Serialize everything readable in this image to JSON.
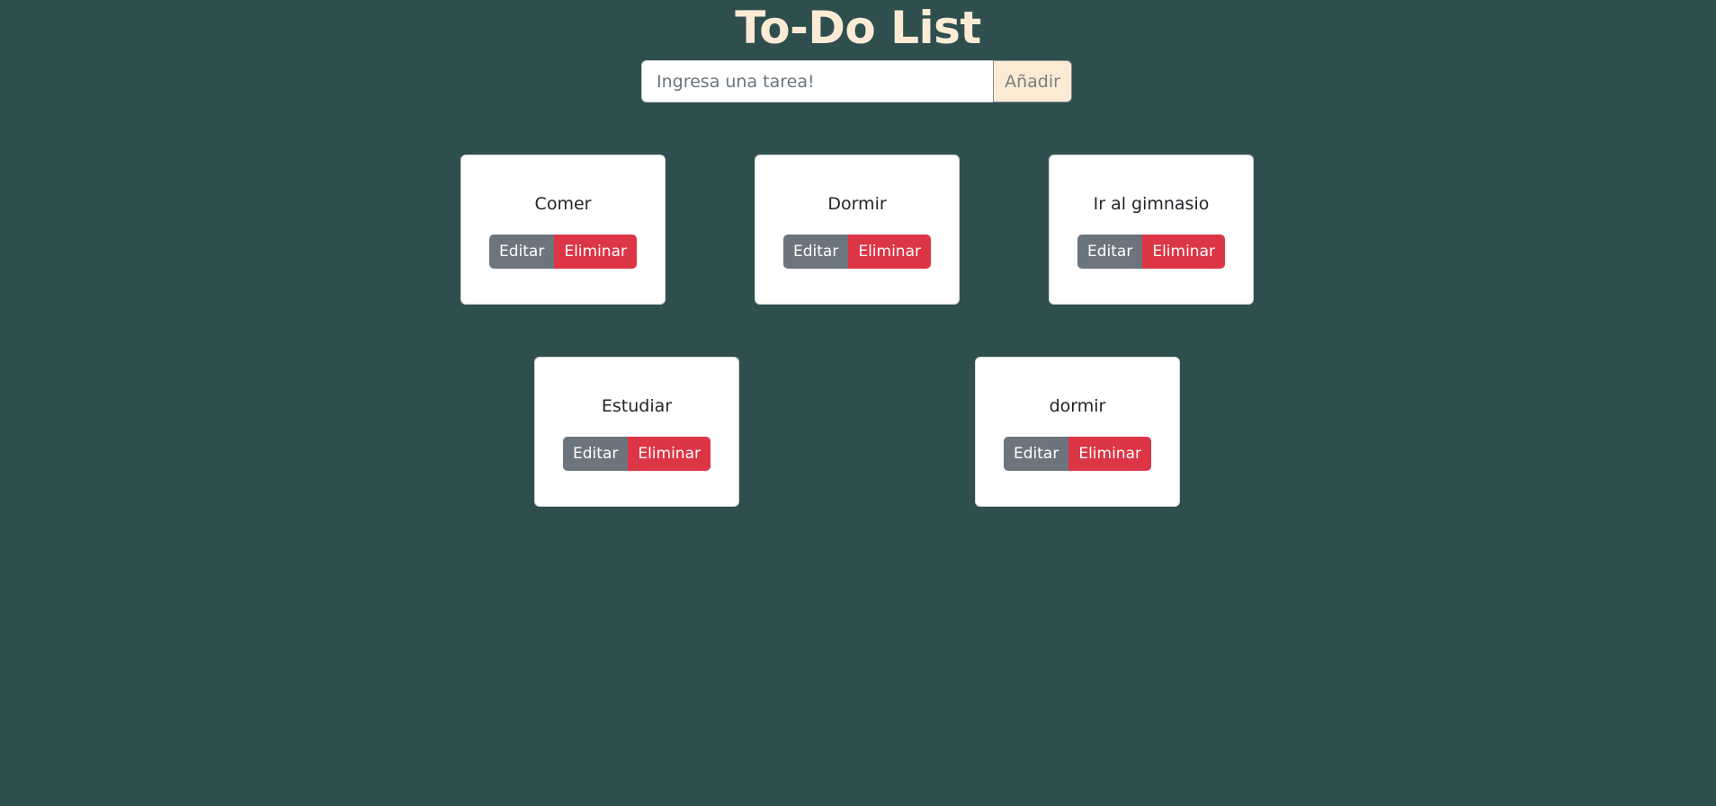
{
  "header": {
    "title": "To-Do List"
  },
  "form": {
    "placeholder": "Ingresa una tarea!",
    "value": "",
    "add_label": "Añadir"
  },
  "tasks": [
    {
      "text": "Comer",
      "edit_label": "Editar",
      "delete_label": "Eliminar"
    },
    {
      "text": "Dormir",
      "edit_label": "Editar",
      "delete_label": "Eliminar"
    },
    {
      "text": "Ir al gimnasio",
      "edit_label": "Editar",
      "delete_label": "Eliminar"
    },
    {
      "text": "Estudiar",
      "edit_label": "Editar",
      "delete_label": "Eliminar"
    },
    {
      "text": "dormir",
      "edit_label": "Editar",
      "delete_label": "Eliminar"
    }
  ],
  "colors": {
    "background": "#2f4f4f",
    "accent": "#fbebd5",
    "edit": "#6c757d",
    "delete": "#dc3545"
  }
}
